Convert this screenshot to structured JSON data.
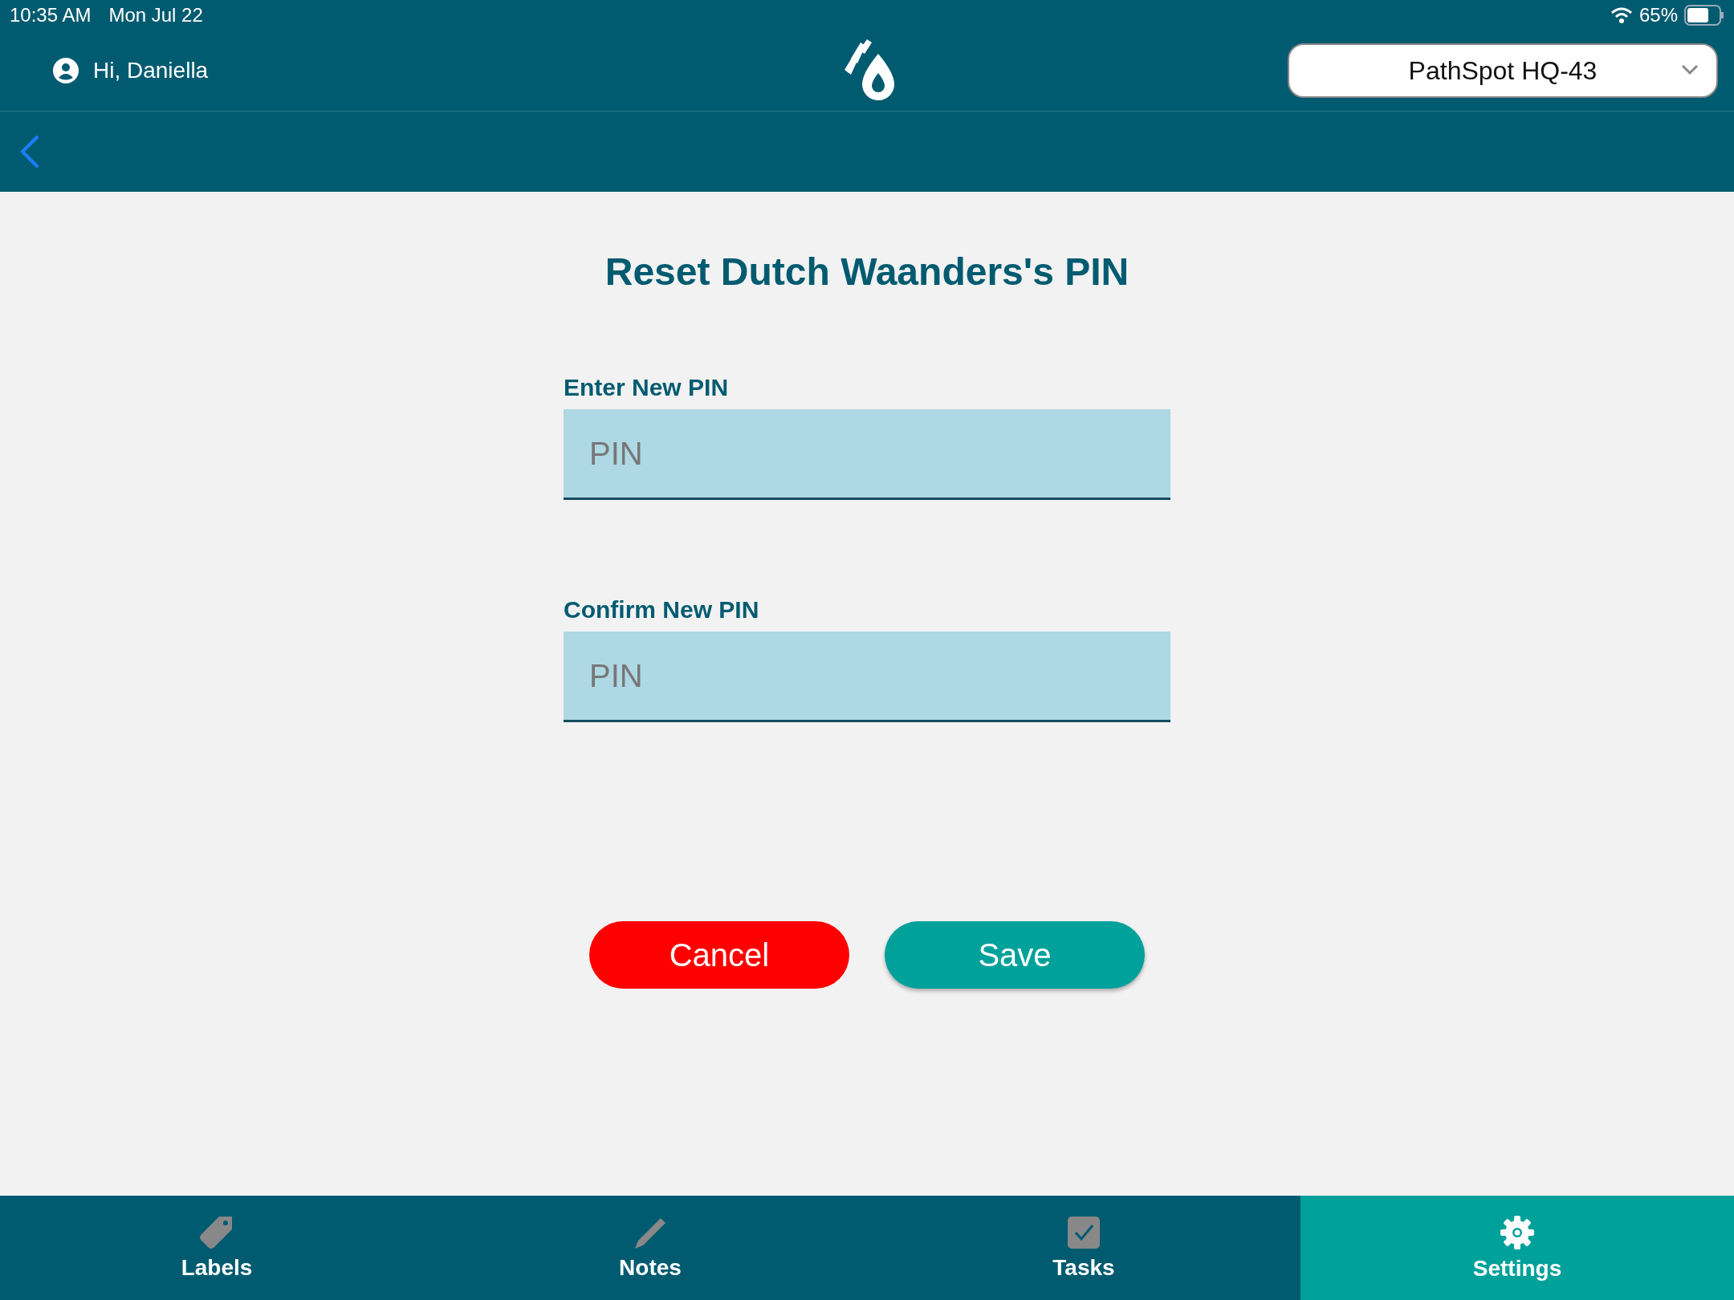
{
  "status_bar": {
    "time": "10:35 AM",
    "date": "Mon Jul 22",
    "battery": "65%"
  },
  "header": {
    "greeting": "Hi, Daniella",
    "location": "PathSpot HQ-43"
  },
  "title": "Reset Dutch Waanders's PIN",
  "fields": [
    {
      "label": "Enter New PIN",
      "placeholder": "PIN"
    },
    {
      "label": "Confirm New PIN",
      "placeholder": "PIN"
    }
  ],
  "buttons": [
    {
      "label": "Cancel",
      "kind": "cancel"
    },
    {
      "label": "Save",
      "kind": "save"
    }
  ],
  "tabs": [
    {
      "label": "Labels",
      "kind": "tag",
      "selected": false
    },
    {
      "label": "Notes",
      "kind": "pencil",
      "selected": false
    },
    {
      "label": "Tasks",
      "kind": "check",
      "selected": false
    },
    {
      "label": "Settings",
      "kind": "gear",
      "selected": true
    }
  ]
}
